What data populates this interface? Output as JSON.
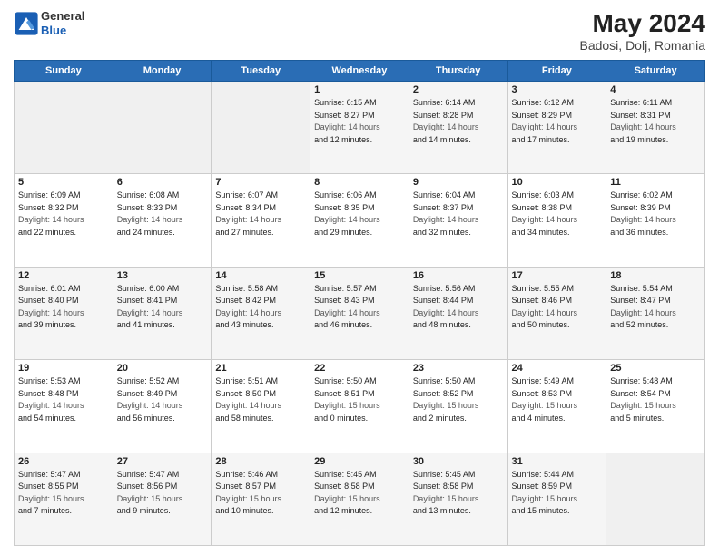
{
  "header": {
    "logo_general": "General",
    "logo_blue": "Blue",
    "month_year": "May 2024",
    "location": "Badosi, Dolj, Romania"
  },
  "days_of_week": [
    "Sunday",
    "Monday",
    "Tuesday",
    "Wednesday",
    "Thursday",
    "Friday",
    "Saturday"
  ],
  "weeks": [
    [
      {
        "num": "",
        "info": ""
      },
      {
        "num": "",
        "info": ""
      },
      {
        "num": "",
        "info": ""
      },
      {
        "num": "1",
        "info": "Sunrise: 6:15 AM\nSunset: 8:27 PM\nDaylight: 14 hours\nand 12 minutes."
      },
      {
        "num": "2",
        "info": "Sunrise: 6:14 AM\nSunset: 8:28 PM\nDaylight: 14 hours\nand 14 minutes."
      },
      {
        "num": "3",
        "info": "Sunrise: 6:12 AM\nSunset: 8:29 PM\nDaylight: 14 hours\nand 17 minutes."
      },
      {
        "num": "4",
        "info": "Sunrise: 6:11 AM\nSunset: 8:31 PM\nDaylight: 14 hours\nand 19 minutes."
      }
    ],
    [
      {
        "num": "5",
        "info": "Sunrise: 6:09 AM\nSunset: 8:32 PM\nDaylight: 14 hours\nand 22 minutes."
      },
      {
        "num": "6",
        "info": "Sunrise: 6:08 AM\nSunset: 8:33 PM\nDaylight: 14 hours\nand 24 minutes."
      },
      {
        "num": "7",
        "info": "Sunrise: 6:07 AM\nSunset: 8:34 PM\nDaylight: 14 hours\nand 27 minutes."
      },
      {
        "num": "8",
        "info": "Sunrise: 6:06 AM\nSunset: 8:35 PM\nDaylight: 14 hours\nand 29 minutes."
      },
      {
        "num": "9",
        "info": "Sunrise: 6:04 AM\nSunset: 8:37 PM\nDaylight: 14 hours\nand 32 minutes."
      },
      {
        "num": "10",
        "info": "Sunrise: 6:03 AM\nSunset: 8:38 PM\nDaylight: 14 hours\nand 34 minutes."
      },
      {
        "num": "11",
        "info": "Sunrise: 6:02 AM\nSunset: 8:39 PM\nDaylight: 14 hours\nand 36 minutes."
      }
    ],
    [
      {
        "num": "12",
        "info": "Sunrise: 6:01 AM\nSunset: 8:40 PM\nDaylight: 14 hours\nand 39 minutes."
      },
      {
        "num": "13",
        "info": "Sunrise: 6:00 AM\nSunset: 8:41 PM\nDaylight: 14 hours\nand 41 minutes."
      },
      {
        "num": "14",
        "info": "Sunrise: 5:58 AM\nSunset: 8:42 PM\nDaylight: 14 hours\nand 43 minutes."
      },
      {
        "num": "15",
        "info": "Sunrise: 5:57 AM\nSunset: 8:43 PM\nDaylight: 14 hours\nand 46 minutes."
      },
      {
        "num": "16",
        "info": "Sunrise: 5:56 AM\nSunset: 8:44 PM\nDaylight: 14 hours\nand 48 minutes."
      },
      {
        "num": "17",
        "info": "Sunrise: 5:55 AM\nSunset: 8:46 PM\nDaylight: 14 hours\nand 50 minutes."
      },
      {
        "num": "18",
        "info": "Sunrise: 5:54 AM\nSunset: 8:47 PM\nDaylight: 14 hours\nand 52 minutes."
      }
    ],
    [
      {
        "num": "19",
        "info": "Sunrise: 5:53 AM\nSunset: 8:48 PM\nDaylight: 14 hours\nand 54 minutes."
      },
      {
        "num": "20",
        "info": "Sunrise: 5:52 AM\nSunset: 8:49 PM\nDaylight: 14 hours\nand 56 minutes."
      },
      {
        "num": "21",
        "info": "Sunrise: 5:51 AM\nSunset: 8:50 PM\nDaylight: 14 hours\nand 58 minutes."
      },
      {
        "num": "22",
        "info": "Sunrise: 5:50 AM\nSunset: 8:51 PM\nDaylight: 15 hours\nand 0 minutes."
      },
      {
        "num": "23",
        "info": "Sunrise: 5:50 AM\nSunset: 8:52 PM\nDaylight: 15 hours\nand 2 minutes."
      },
      {
        "num": "24",
        "info": "Sunrise: 5:49 AM\nSunset: 8:53 PM\nDaylight: 15 hours\nand 4 minutes."
      },
      {
        "num": "25",
        "info": "Sunrise: 5:48 AM\nSunset: 8:54 PM\nDaylight: 15 hours\nand 5 minutes."
      }
    ],
    [
      {
        "num": "26",
        "info": "Sunrise: 5:47 AM\nSunset: 8:55 PM\nDaylight: 15 hours\nand 7 minutes."
      },
      {
        "num": "27",
        "info": "Sunrise: 5:47 AM\nSunset: 8:56 PM\nDaylight: 15 hours\nand 9 minutes."
      },
      {
        "num": "28",
        "info": "Sunrise: 5:46 AM\nSunset: 8:57 PM\nDaylight: 15 hours\nand 10 minutes."
      },
      {
        "num": "29",
        "info": "Sunrise: 5:45 AM\nSunset: 8:58 PM\nDaylight: 15 hours\nand 12 minutes."
      },
      {
        "num": "30",
        "info": "Sunrise: 5:45 AM\nSunset: 8:58 PM\nDaylight: 15 hours\nand 13 minutes."
      },
      {
        "num": "31",
        "info": "Sunrise: 5:44 AM\nSunset: 8:59 PM\nDaylight: 15 hours\nand 15 minutes."
      },
      {
        "num": "",
        "info": ""
      }
    ]
  ]
}
